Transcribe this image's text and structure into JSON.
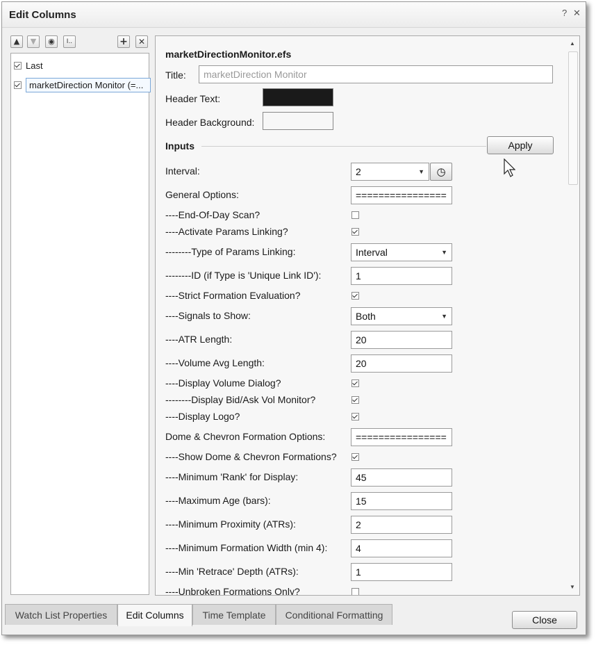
{
  "dialog": {
    "title": "Edit Columns",
    "help_icon": "?",
    "close_icon": "✕"
  },
  "left_toolbar": {
    "icons": [
      "move-up-icon",
      "move-down-icon",
      "eye-icon",
      "text-cursor-icon",
      "plus-icon",
      "close-icon"
    ]
  },
  "columns": [
    {
      "label": "Last",
      "checked": true
    },
    {
      "label": "marketDirection Monitor (=...",
      "checked": true
    }
  ],
  "panel": {
    "file": "marketDirectionMonitor.efs",
    "title_label": "Title:",
    "title_placeholder": "marketDirection Monitor",
    "header_text_label": "Header Text:",
    "header_text_color": "#1a1a1a",
    "header_bg_label": "Header Background:",
    "header_bg_color": "#f7f7f7",
    "inputs_label": "Inputs",
    "apply_label": "Apply"
  },
  "rows": [
    {
      "label": "Interval:",
      "type": "select",
      "value": "2",
      "extra": "clock"
    },
    {
      "label": "General Options:",
      "type": "text",
      "value": "================"
    },
    {
      "label": "----End-Of-Day Scan?",
      "type": "check",
      "checked": false
    },
    {
      "label": "----Activate Params Linking?",
      "type": "check",
      "checked": true
    },
    {
      "label": "--------Type of Params Linking:",
      "type": "select",
      "value": "Interval"
    },
    {
      "label": "--------ID (if Type is 'Unique Link ID'):",
      "type": "text",
      "value": "1"
    },
    {
      "label": "----Strict Formation Evaluation?",
      "type": "check",
      "checked": true
    },
    {
      "label": "----Signals to Show:",
      "type": "select",
      "value": "Both"
    },
    {
      "label": "----ATR Length:",
      "type": "text",
      "value": "20"
    },
    {
      "label": "----Volume Avg Length:",
      "type": "text",
      "value": "20"
    },
    {
      "label": "----Display Volume Dialog?",
      "type": "check",
      "checked": true
    },
    {
      "label": "--------Display Bid/Ask Vol Monitor?",
      "type": "check",
      "checked": true
    },
    {
      "label": "----Display Logo?",
      "type": "check",
      "checked": true
    },
    {
      "label": "Dome & Chevron Formation Options:",
      "type": "text",
      "value": "================"
    },
    {
      "label": "----Show Dome & Chevron Formations?",
      "type": "check",
      "checked": true
    },
    {
      "label": "----Minimum 'Rank' for Display:",
      "type": "text",
      "value": "45"
    },
    {
      "label": "----Maximum Age (bars):",
      "type": "text",
      "value": "15"
    },
    {
      "label": "----Minimum Proximity (ATRs):",
      "type": "text",
      "value": "2"
    },
    {
      "label": "----Minimum Formation Width (min 4):",
      "type": "text",
      "value": "4"
    },
    {
      "label": "----Min 'Retrace' Depth (ATRs):",
      "type": "text",
      "value": "1"
    },
    {
      "label": "----Unbroken Formations Only?",
      "type": "check",
      "checked": false
    }
  ],
  "tabs": [
    {
      "label": "Watch List Properties",
      "active": false
    },
    {
      "label": "Edit Columns",
      "active": true
    },
    {
      "label": "Time Template",
      "active": false
    },
    {
      "label": "Conditional Formatting",
      "active": false
    }
  ],
  "footer": {
    "close_label": "Close"
  }
}
